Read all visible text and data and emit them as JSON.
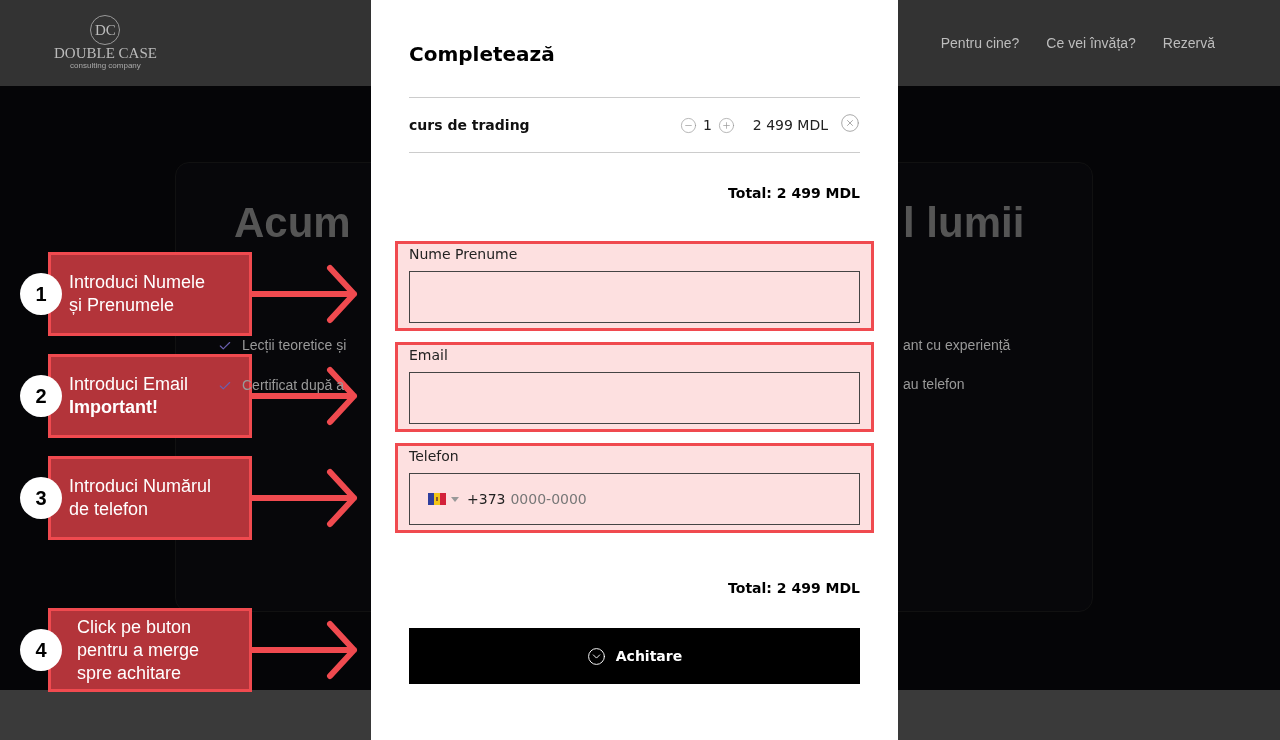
{
  "header": {
    "logo": {
      "monogram": "DC",
      "name": "DOUBLE CASE",
      "tagline": "consulting company"
    },
    "nav": [
      "Pentru cine?",
      "Ce vei învăța?",
      "Rezervă"
    ]
  },
  "hero": {
    "heading_left": "Acum",
    "heading_right": "l lumii",
    "features": [
      {
        "left": "Lecții teoretice și",
        "right": "ant cu experiență"
      },
      {
        "left": "Certificat după a",
        "right": "au telefon"
      }
    ]
  },
  "modal": {
    "title": "Completează",
    "cart": [
      {
        "name": "curs de trading",
        "quantity": "1",
        "price": "2 499 MDL"
      }
    ],
    "total": "Total: 2 499 MDL",
    "fields": [
      {
        "kind": "text",
        "label": "Nume Prenume"
      },
      {
        "kind": "text",
        "label": "Email"
      },
      {
        "kind": "phone",
        "label": "Telefon",
        "prefix": "+373",
        "placeholder": "0000-0000"
      }
    ],
    "total_bottom": "Total: 2 499 MDL",
    "submit": "Achitare"
  },
  "annotations": [
    {
      "number": "1",
      "lines": [
        "Introduci Numele",
        "și Prenumele"
      ]
    },
    {
      "number": "2",
      "lines": [
        "Introduci Email",
        "**Important!**"
      ]
    },
    {
      "number": "3",
      "lines": [
        "Introduci Numărul",
        "de telefon"
      ]
    },
    {
      "number": "4",
      "lines": [
        "Click pe buton",
        "pentru a merge",
        "spre achitare"
      ]
    }
  ]
}
